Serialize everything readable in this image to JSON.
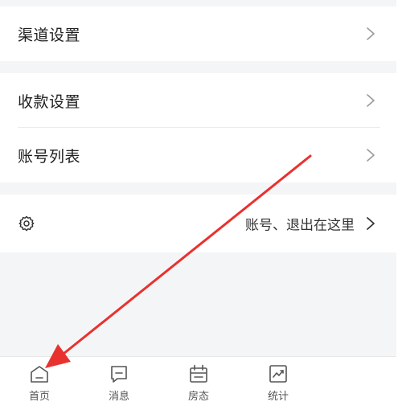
{
  "menu": {
    "channel_settings": "渠道设置",
    "payment_settings": "收款设置",
    "account_list": "账号列表"
  },
  "settings": {
    "hint": "账号、退出在这里"
  },
  "tabbar": {
    "home": "首页",
    "messages": "消息",
    "room_status": "房态",
    "statistics": "统计"
  },
  "colors": {
    "annotation_arrow": "#e8322f",
    "background": "#f4f5f7"
  }
}
